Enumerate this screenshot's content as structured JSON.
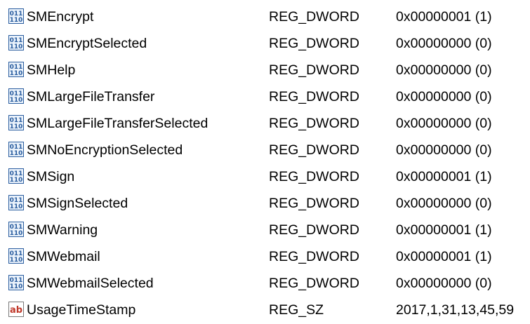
{
  "registry_values": {
    "rows": [
      {
        "name": "SMEncrypt",
        "type": "REG_DWORD",
        "data": "0x00000001 (1)",
        "icon": "binary-value-icon"
      },
      {
        "name": "SMEncryptSelected",
        "type": "REG_DWORD",
        "data": "0x00000000 (0)",
        "icon": "binary-value-icon"
      },
      {
        "name": "SMHelp",
        "type": "REG_DWORD",
        "data": "0x00000000 (0)",
        "icon": "binary-value-icon"
      },
      {
        "name": "SMLargeFileTransfer",
        "type": "REG_DWORD",
        "data": "0x00000000 (0)",
        "icon": "binary-value-icon"
      },
      {
        "name": "SMLargeFileTransferSelected",
        "type": "REG_DWORD",
        "data": "0x00000000 (0)",
        "icon": "binary-value-icon"
      },
      {
        "name": "SMNoEncryptionSelected",
        "type": "REG_DWORD",
        "data": "0x00000000 (0)",
        "icon": "binary-value-icon"
      },
      {
        "name": "SMSign",
        "type": "REG_DWORD",
        "data": "0x00000001 (1)",
        "icon": "binary-value-icon"
      },
      {
        "name": "SMSignSelected",
        "type": "REG_DWORD",
        "data": "0x00000000 (0)",
        "icon": "binary-value-icon"
      },
      {
        "name": "SMWarning",
        "type": "REG_DWORD",
        "data": "0x00000001 (1)",
        "icon": "binary-value-icon"
      },
      {
        "name": "SMWebmail",
        "type": "REG_DWORD",
        "data": "0x00000001 (1)",
        "icon": "binary-value-icon"
      },
      {
        "name": "SMWebmailSelected",
        "type": "REG_DWORD",
        "data": "0x00000000 (0)",
        "icon": "binary-value-icon"
      },
      {
        "name": "UsageTimeStamp",
        "type": "REG_SZ",
        "data": "2017,1,31,13,45,59",
        "icon": "string-value-icon"
      }
    ]
  },
  "colors": {
    "binary_icon": "#2a5d9f",
    "binary_icon_bg": "#eaf2fb",
    "string_icon_text": "#c0392b",
    "text": "#000000"
  }
}
